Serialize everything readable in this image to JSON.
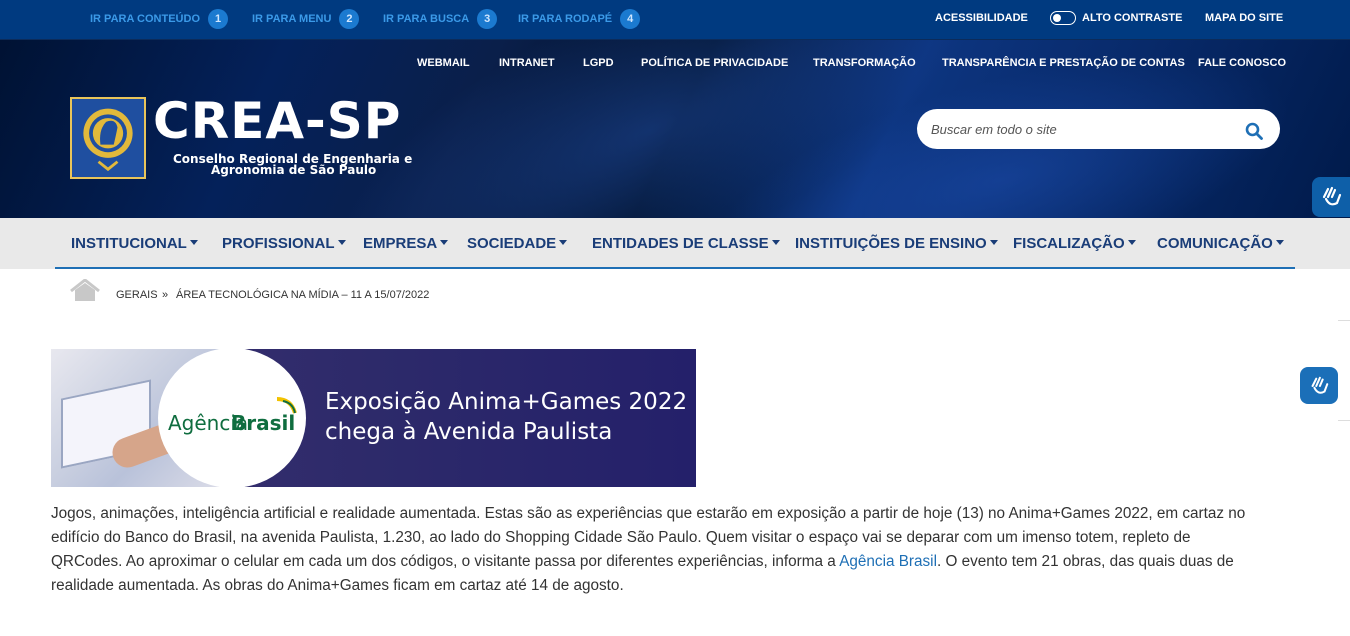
{
  "topbar": {
    "skip_links": [
      {
        "label": "IR PARA CONTEÚDO",
        "num": "1"
      },
      {
        "label": "IR PARA MENU",
        "num": "2"
      },
      {
        "label": "IR PARA BUSCA",
        "num": "3"
      },
      {
        "label": "IR PARA RODAPÉ",
        "num": "4"
      }
    ],
    "accessibility": "ACESSIBILIDADE",
    "high_contrast": "ALTO CONTRASTE",
    "site_map": "MAPA DO SITE"
  },
  "header": {
    "links": [
      "WEBMAIL",
      "INTRANET",
      "LGPD",
      "POLÍTICA DE PRIVACIDADE",
      "TRANSFORMAÇÃO",
      "TRANSPARÊNCIA E PRESTAÇÃO DE CONTAS",
      "FALE CONOSCO"
    ],
    "logo_title": "CREA-SP",
    "logo_subtitle_line1": "Conselho Regional de Engenharia e",
    "logo_subtitle_line2": "Agronomia de São Paulo",
    "search_placeholder": "Buscar em todo o site"
  },
  "nav": {
    "items": [
      "INSTITUCIONAL",
      "PROFISSIONAL",
      "EMPRESA",
      "SOCIEDADE",
      "ENTIDADES DE CLASSE",
      "INSTITUIÇÕES DE ENSINO",
      "FISCALIZAÇÃO",
      "COMUNICAÇÃO"
    ]
  },
  "breadcrumb": {
    "section": "GERAIS",
    "separator": "»",
    "current": "ÁREA TECNOLÓGICA NA MÍDIA – 11 A 15/07/2022"
  },
  "banner": {
    "brand_regular": "Agência",
    "brand_bold": "Brasil",
    "title_line1": "Exposição Anima+Games 2022",
    "title_line2": "chega à Avenida Paulista"
  },
  "article": {
    "text_before_link": "Jogos, animações, inteligência artificial e realidade aumentada. Estas são as experiências que estarão em exposição a partir de hoje (13) no Anima+Games 2022, em cartaz no edifício do Banco do Brasil, na avenida Paulista, 1.230, ao lado do Shopping Cidade São Paulo. Quem visitar o espaço vai se deparar com um imenso totem, repleto de QRCodes. Ao aproximar o celular em cada um dos códigos, o visitante passa por diferentes experiências, informa a ",
    "link_text": "Agência Brasil",
    "text_after_link": ". O evento tem 21 obras, das quais duas de realidade aumentada.  As obras do Anima+Games ficam em cartaz até 14 de agosto."
  },
  "colors": {
    "topbar": "#003a80",
    "nav_text": "#1a3d78",
    "accent": "#1e6fb5"
  }
}
